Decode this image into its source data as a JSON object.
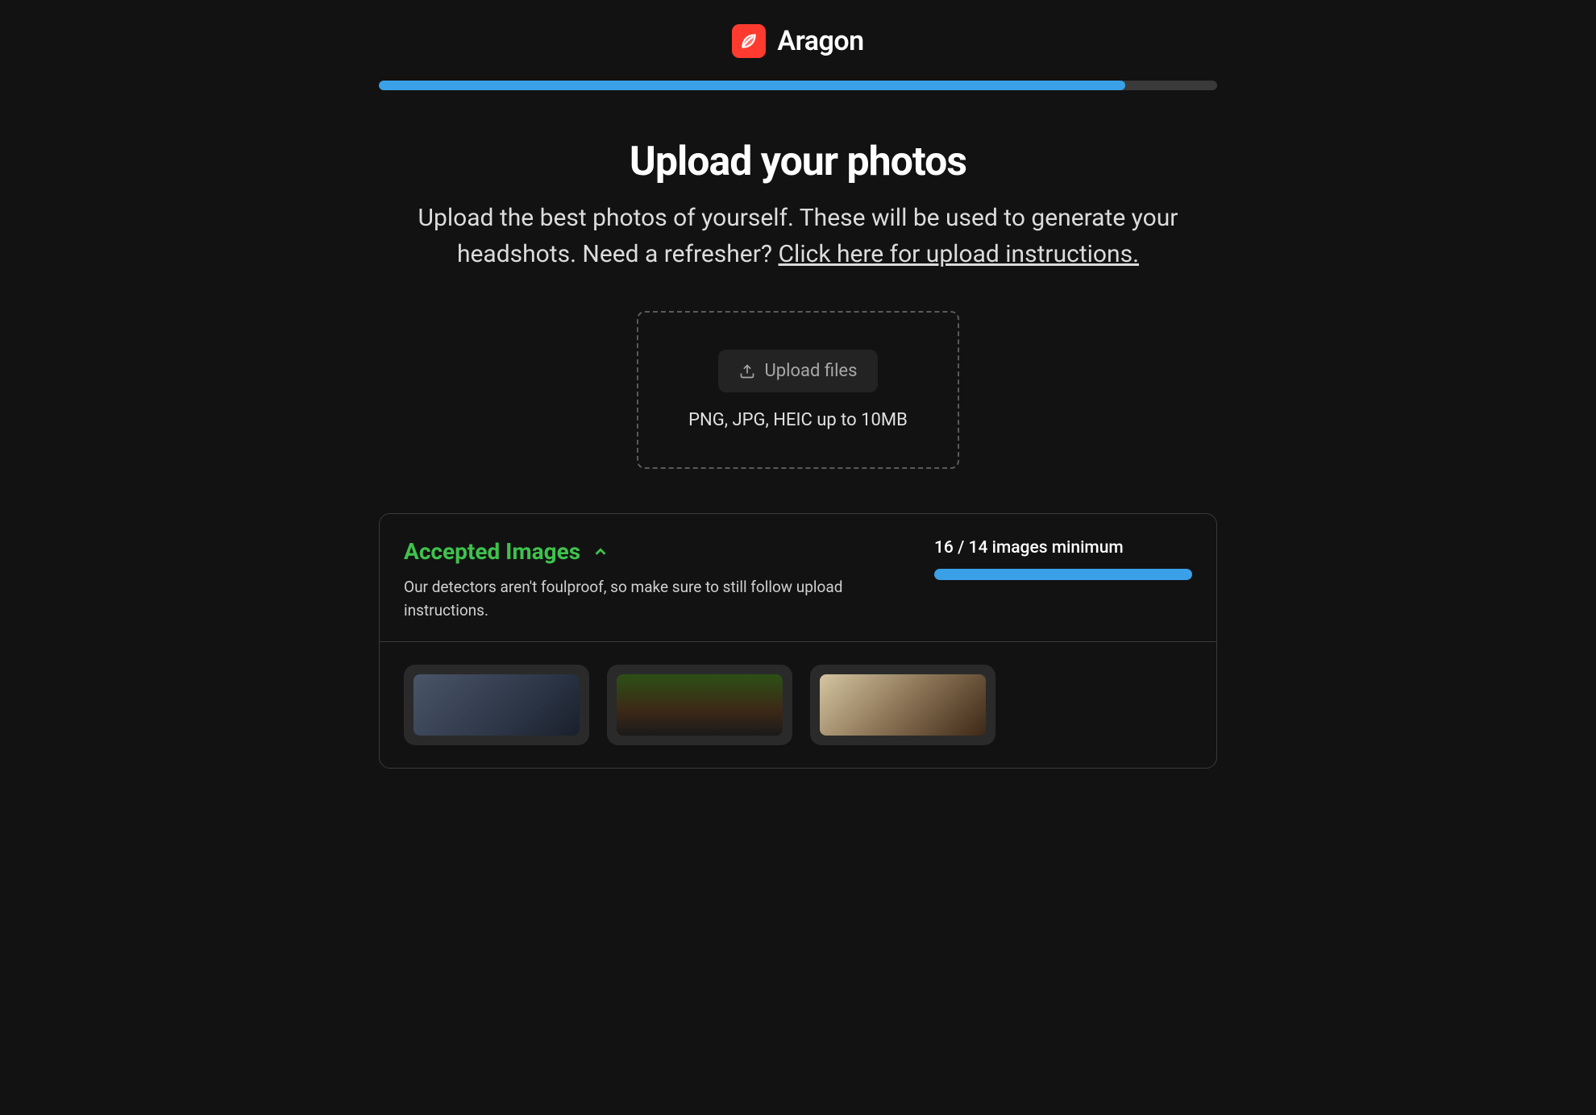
{
  "header": {
    "brand_name": "Aragon"
  },
  "progress": {
    "percent": 89
  },
  "main": {
    "title": "Upload your photos",
    "subtitle_prefix": "Upload the best photos of yourself. These will be used to generate your headshots. Need a refresher? ",
    "subtitle_link": "Click here for upload instructions."
  },
  "dropzone": {
    "button_label": "Upload files",
    "file_types": "PNG, JPG, HEIC up to 10MB"
  },
  "accepted": {
    "title": "Accepted Images",
    "subtitle": "Our detectors aren't foulproof, so make sure to still follow upload instructions.",
    "count_label": "16 / 14 images minimum",
    "count_current": 16,
    "count_minimum": 14,
    "count_percent": 100
  }
}
